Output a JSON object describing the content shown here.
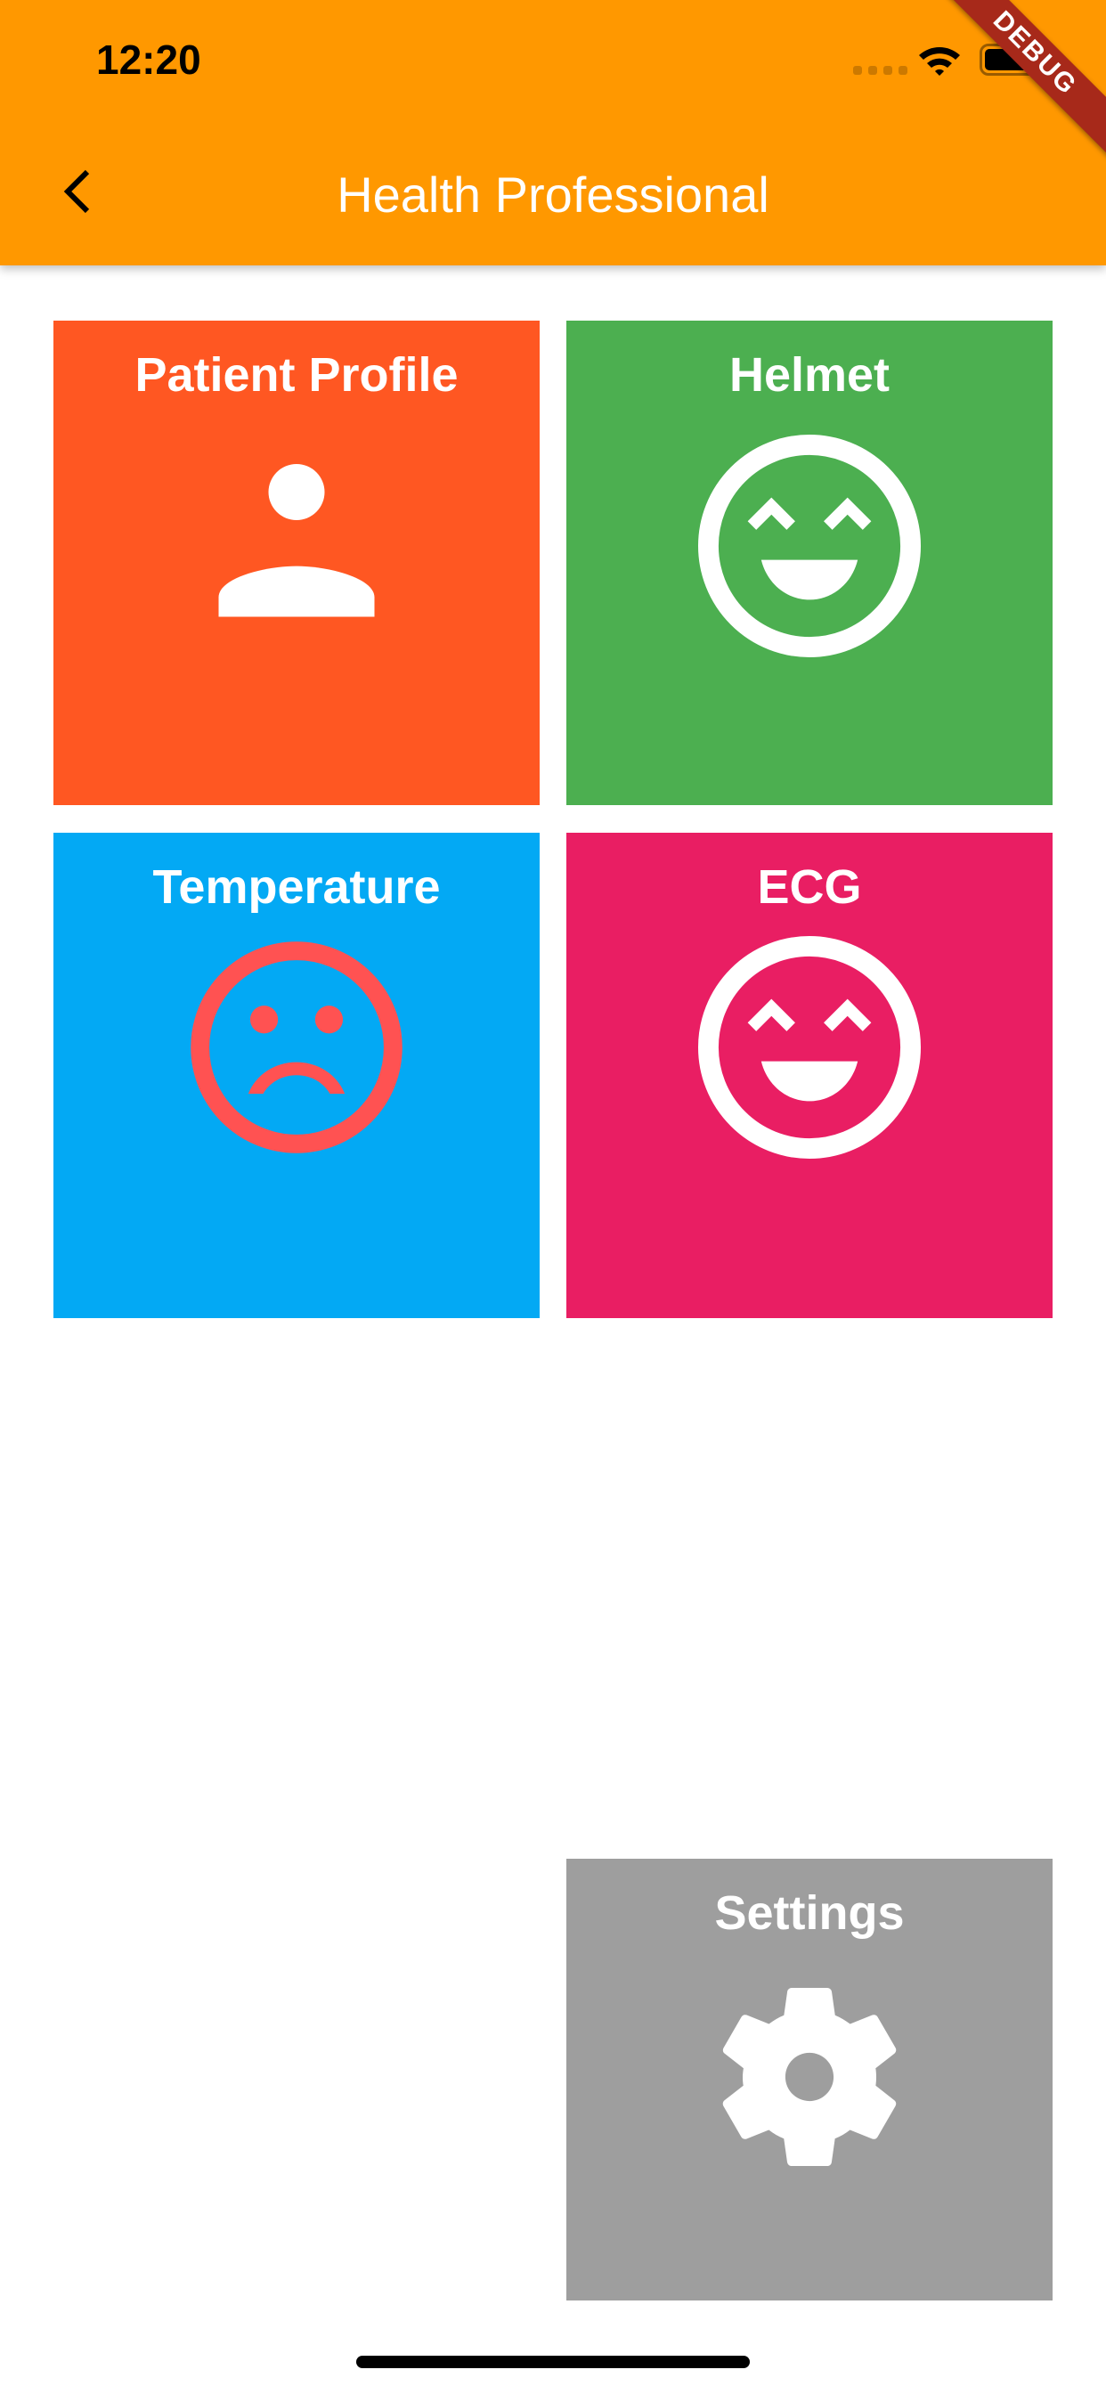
{
  "status_bar": {
    "time": "12:20"
  },
  "debug_banner": "DEBUG",
  "app_bar": {
    "title": "Health Professional",
    "back_icon": "chevron-left-icon"
  },
  "tiles": [
    {
      "label": "Patient Profile",
      "icon": "person-icon",
      "color": "#FF5722"
    },
    {
      "label": "Helmet",
      "icon": "very-satisfied-face-icon",
      "color": "#4CAF50"
    },
    {
      "label": "Temperature",
      "icon": "dissatisfied-face-icon",
      "color": "#03A9F4",
      "icon_color": "#FF5252"
    },
    {
      "label": "ECG",
      "icon": "very-satisfied-face-icon",
      "color": "#E91E63"
    },
    {
      "label": "Settings",
      "icon": "gear-icon",
      "color": "#9E9E9E"
    }
  ]
}
